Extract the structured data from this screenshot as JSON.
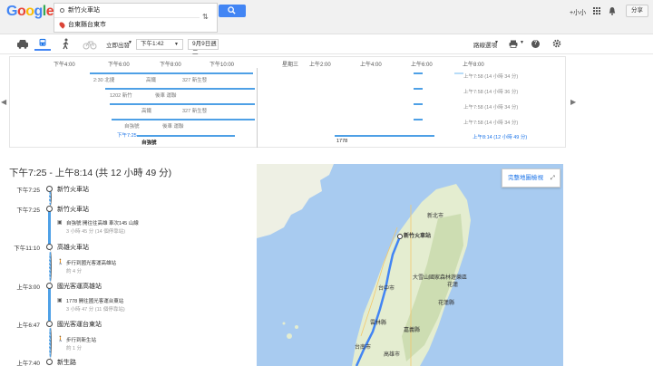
{
  "header": {
    "logo_letters": [
      "G",
      "o",
      "o",
      "g",
      "l",
      "e"
    ],
    "origin": "新竹火車站",
    "destination": "台東縣台東市",
    "user": "+小小",
    "share": "分享"
  },
  "toolbar": {
    "depart_mode": "立即出發",
    "time": "下午1:42",
    "date": "9月9日週二",
    "route_options": "路線選項",
    "help": "?",
    "modes": [
      "car-icon",
      "transit-icon",
      "walk-icon",
      "bike-icon"
    ]
  },
  "timeline": {
    "ticks": [
      "下午4:00",
      "下午6:00",
      "下午8:00",
      "下午10:00",
      "星期三",
      "上午2:00",
      "上午4:00",
      "上午6:00",
      "上午8:00"
    ],
    "rows": [
      {
        "labels": [
          "2:30 北捷",
          "高鐵",
          "327 新生發"
        ],
        "time": "上午7:58 (14 小時 34 分)"
      },
      {
        "labels": [
          "1202 新竹",
          "後車 運聯"
        ],
        "time": "上午7:58 (14 小時 36 分)"
      },
      {
        "labels": [
          "高鐵",
          "327 新生發"
        ],
        "time": "上午7:58 (14 小時 34 分)"
      },
      {
        "labels": [
          "自強號",
          "後車 運聯"
        ],
        "time": "上午7:58 (14 小時 34 分)"
      },
      {
        "labels": [
          "自強號",
          "後車 運聯"
        ],
        "time": "上午7:58 (14 小時 34 分)"
      },
      {
        "labels": [
          "自強號",
          "1778"
        ],
        "time": "上午8:14 (12 小時 49 分)",
        "start": "下午7:25"
      }
    ]
  },
  "itinerary": {
    "title": "下午7:25 - 上午8:14 (共 12 小時 49 分)",
    "steps": [
      {
        "time": "下午7:25",
        "station": "新竹火車站"
      },
      {
        "time": "下午7:25",
        "station": "新竹火車站"
      },
      {
        "detail": "自強號 開往往高雄 車次145 山線",
        "sub": "3 小時 45 分 (14 個停靠站)"
      },
      {
        "time": "下午11:10",
        "station": "高雄火車站"
      },
      {
        "detail": "步行到國光客運高雄站",
        "sub": "約 4 分"
      },
      {
        "time": "上午3:00",
        "station": "國光客運高雄站"
      },
      {
        "detail": "1778 開往國光客運台東站",
        "sub": "3 小時 47 分 (11 個停靠站)"
      },
      {
        "time": "上午6:47",
        "station": "國光客運台東站"
      },
      {
        "detail": "步行到新生站",
        "sub": "約 1 分"
      },
      {
        "time": "上午7:40",
        "station": "新生路"
      }
    ]
  },
  "map": {
    "button": "完整地圖檢視",
    "labels": [
      "新北市",
      "新竹火車站",
      "台中市",
      "大雪山國家森林遊樂區",
      "花蓮縣",
      "雲林縣",
      "嘉義縣",
      "高雄市",
      "台南市",
      "花蓮"
    ]
  },
  "colors": {
    "accent": "#4285f4",
    "route": "#4ea0e6"
  }
}
